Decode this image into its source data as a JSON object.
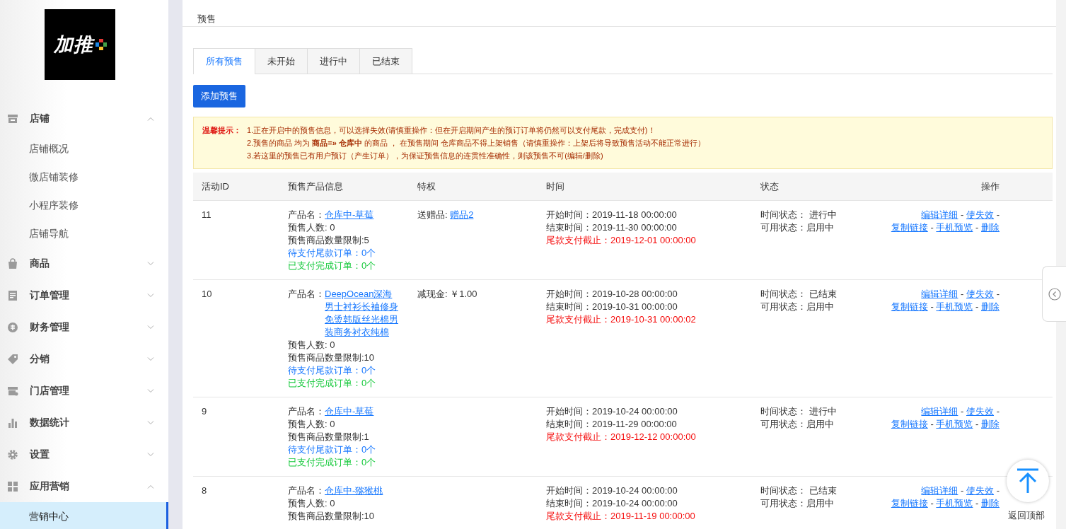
{
  "sidebar": {
    "logo": "加推",
    "groups": [
      {
        "kind": "store",
        "label": "店铺",
        "expanded": true,
        "children": [
          {
            "label": "店铺概况",
            "selected": false
          },
          {
            "label": "微店铺装修",
            "selected": false
          },
          {
            "label": "小程序装修",
            "selected": false
          },
          {
            "label": "店铺导航",
            "selected": false
          }
        ]
      },
      {
        "kind": "bag",
        "label": "商品",
        "expanded": false
      },
      {
        "kind": "doc",
        "label": "订单管理",
        "expanded": false
      },
      {
        "kind": "money",
        "label": "财务管理",
        "expanded": false
      },
      {
        "kind": "tag",
        "label": "分销",
        "expanded": false
      },
      {
        "kind": "shop",
        "label": "门店管理",
        "expanded": false
      },
      {
        "kind": "chart",
        "label": "数据统计",
        "expanded": false
      },
      {
        "kind": "gear",
        "label": "设置",
        "expanded": false
      },
      {
        "kind": "grid",
        "label": "应用营销",
        "expanded": true,
        "children": [
          {
            "label": "营销中心",
            "selected": true
          }
        ]
      }
    ]
  },
  "page_title": "预售",
  "tabs": [
    {
      "label": "所有预售",
      "selected": true
    },
    {
      "label": "未开始",
      "selected": false
    },
    {
      "label": "进行中",
      "selected": false
    },
    {
      "label": "已结束",
      "selected": false
    }
  ],
  "add_button": "添加预售",
  "notice": {
    "label": "温馨提示：",
    "lines": [
      "1.正在开启中的预售信息，可以选择失效(请慎重操作：但在开启期间产生的预订订单将仍然可以支付尾款，完成支付)！",
      "2.预售的商品 均为 **商品=» 仓库中** 的商品 ， 在预售期间 仓库商品不得上架销售（请慎重操作：上架后将导致预售活动不能正常进行）",
      "3.若这里的预售已有用户预订（产生订单），为保证预售信息的连贯性准确性，则该预售不可(编辑/删除)"
    ]
  },
  "table": {
    "columns": [
      "活动ID",
      "预售产品信息",
      "特权",
      "时间",
      "状态",
      "操作"
    ],
    "rows": [
      {
        "id": "11",
        "product_label": "产品名：",
        "product_name": "仓库中-草莓",
        "count": "预售人数: 0",
        "limit": "预售商品数量限制:5",
        "pending": "待支付尾款订单：0个",
        "paid": "已支付完成订单：0个",
        "privilege": {
          "kind": "gift",
          "label": "送赠品:",
          "value": "赠品2"
        },
        "start": "开始时间：2019-11-18 00:00:00",
        "end": "结束时间：2019-11-30 00:00:00",
        "deadline": "尾款支付截止：2019-12-01 00:00:00",
        "time_status": "时间状态：  进行中",
        "use_status": "可用状态：启用中",
        "actions": [
          {
            "kind": "link",
            "text": "编辑详细"
          },
          {
            "kind": "separator",
            "text": "-"
          },
          {
            "kind": "link",
            "text": "使失效"
          },
          {
            "kind": "separator",
            "text": "-"
          },
          {
            "kind": "link",
            "text": "复制链接"
          },
          {
            "kind": "separator",
            "text": "-"
          },
          {
            "kind": "link",
            "text": "手机预览"
          },
          {
            "kind": "separator",
            "text": "-"
          },
          {
            "kind": "link",
            "text": "删除"
          }
        ]
      },
      {
        "id": "10",
        "product_label": "产品名：",
        "product_name": "DeepOcean深海男士衬衫长袖修身免烫韩版丝光棉男装商务衬衣纯棉",
        "count": "预售人数: 0",
        "limit": "预售商品数量限制:10",
        "pending": "待支付尾款订单：0个",
        "paid": "已支付完成订单：0个",
        "privilege": {
          "kind": "cash",
          "label": "减现金:",
          "value": "￥1.00"
        },
        "start": "开始时间：2019-10-28 00:00:00",
        "end": "结束时间：2019-10-31 00:00:00",
        "deadline": "尾款支付截止：2019-10-31 00:00:02",
        "time_status": "时间状态：  已结束",
        "use_status": "可用状态：启用中",
        "actions": [
          {
            "kind": "link",
            "text": "编辑详细"
          },
          {
            "kind": "separator",
            "text": "-"
          },
          {
            "kind": "link",
            "text": "使失效"
          },
          {
            "kind": "separator",
            "text": "-"
          },
          {
            "kind": "link",
            "text": "复制链接"
          },
          {
            "kind": "separator",
            "text": "-"
          },
          {
            "kind": "link",
            "text": "手机预览"
          },
          {
            "kind": "separator",
            "text": "-"
          },
          {
            "kind": "link",
            "text": "删除"
          }
        ]
      },
      {
        "id": "9",
        "product_label": "产品名：",
        "product_name": "仓库中-草莓",
        "count": "预售人数: 0",
        "limit": "预售商品数量限制:1",
        "pending": "待支付尾款订单：0个",
        "paid": "已支付完成订单：0个",
        "start": "开始时间：2019-10-24 00:00:00",
        "end": "结束时间：2019-11-29 00:00:00",
        "deadline": "尾款支付截止：2019-12-12 00:00:00",
        "time_status": "时间状态：  进行中",
        "use_status": "可用状态：启用中",
        "actions": [
          {
            "kind": "link",
            "text": "编辑详细"
          },
          {
            "kind": "separator",
            "text": "-"
          },
          {
            "kind": "link",
            "text": "使失效"
          },
          {
            "kind": "separator",
            "text": "-"
          },
          {
            "kind": "link",
            "text": "复制链接"
          },
          {
            "kind": "separator",
            "text": "-"
          },
          {
            "kind": "link",
            "text": "手机预览"
          },
          {
            "kind": "separator",
            "text": "-"
          },
          {
            "kind": "link",
            "text": "删除"
          }
        ]
      },
      {
        "id": "8",
        "product_label": "产品名：",
        "product_name": "仓库中-猕猴桃",
        "count": "预售人数: 0",
        "limit": "预售商品数量限制:10",
        "start": "开始时间：2019-10-24 00:00:00",
        "end": "结束时间：2019-10-24 00:00:00",
        "deadline": "尾款支付截止：2019-11-19 00:00:00",
        "time_status": "时间状态：  已结束",
        "use_status": "可用状态：启用中",
        "actions": [
          {
            "kind": "link",
            "text": "编辑详细"
          },
          {
            "kind": "separator",
            "text": "-"
          },
          {
            "kind": "link",
            "text": "使失效"
          },
          {
            "kind": "separator",
            "text": "-"
          },
          {
            "kind": "link",
            "text": "复制链接"
          },
          {
            "kind": "separator",
            "text": "-"
          },
          {
            "kind": "link",
            "text": "手机预览"
          },
          {
            "kind": "separator",
            "text": "-"
          },
          {
            "kind": "link",
            "text": "删除"
          }
        ]
      }
    ]
  },
  "back_to_top": "返回顶部"
}
